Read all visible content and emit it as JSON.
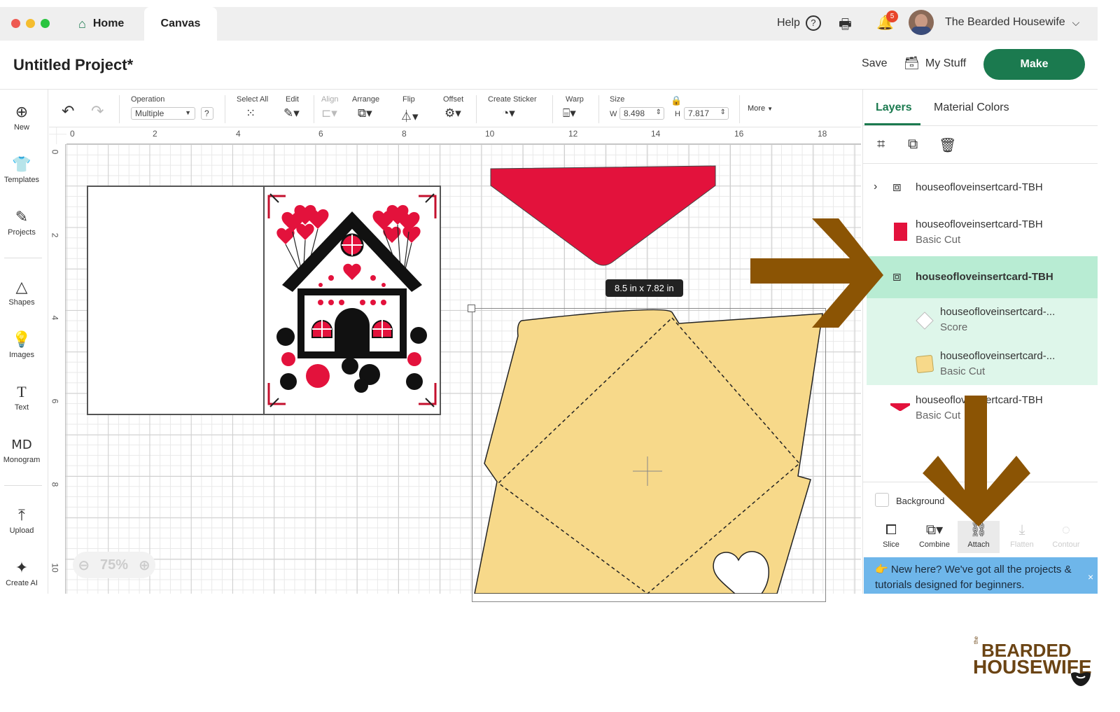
{
  "window": {
    "tabs": [
      {
        "label": "Home"
      },
      {
        "label": "Canvas"
      }
    ],
    "help_label": "Help",
    "notification_count": "5",
    "user_name": "The Bearded Housewife"
  },
  "header": {
    "project_title": "Untitled Project*",
    "save_label": "Save",
    "mystuff_label": "My Stuff",
    "make_label": "Make"
  },
  "sidebar": {
    "items": [
      {
        "label": "New",
        "icon": "plus-circle-icon"
      },
      {
        "label": "Templates",
        "icon": "shirt-icon"
      },
      {
        "label": "Projects",
        "icon": "projects-icon"
      },
      {
        "label": "Shapes",
        "icon": "shapes-icon"
      },
      {
        "label": "Images",
        "icon": "lightbulb-icon"
      },
      {
        "label": "Text",
        "icon": "text-icon"
      },
      {
        "label": "Monogram",
        "icon": "monogram-icon"
      },
      {
        "label": "Upload",
        "icon": "upload-icon"
      },
      {
        "label": "Create AI",
        "icon": "sparkle-icon"
      }
    ]
  },
  "toolbar": {
    "operation_label": "Operation",
    "operation_value": "Multiple",
    "operation_help": "?",
    "select_all_label": "Select All",
    "edit_label": "Edit",
    "align_label": "Align",
    "arrange_label": "Arrange",
    "flip_label": "Flip",
    "offset_label": "Offset",
    "create_sticker_label": "Create Sticker",
    "warp_label": "Warp",
    "size_label": "Size",
    "width_prefix": "W",
    "width_value": "8.498",
    "height_prefix": "H",
    "height_value": "7.817",
    "more_label": "More"
  },
  "canvas": {
    "ruler_top": [
      "0",
      "2",
      "4",
      "6",
      "8",
      "10",
      "12",
      "14",
      "16",
      "18"
    ],
    "ruler_left": [
      "0",
      "2",
      "4",
      "6",
      "8",
      "10"
    ],
    "size_tooltip": "8.5  in x 7.82  in",
    "zoom_level": "75%"
  },
  "panel": {
    "tabs": [
      {
        "label": "Layers"
      },
      {
        "label": "Material Colors"
      }
    ],
    "layers": [
      {
        "name": "houseofloveinsertcard-TBH",
        "sub": ""
      },
      {
        "name": "houseofloveinsertcard-TBH",
        "sub": "Basic Cut",
        "color": "#e3123c"
      },
      {
        "name": "houseofloveinsertcard-TBH",
        "sub": ""
      },
      {
        "name": "houseofloveinsertcard-...",
        "sub": "Score"
      },
      {
        "name": "houseofloveinsertcard-...",
        "sub": "Basic Cut",
        "color": "#f7d98a"
      },
      {
        "name": "houseofloveinsertcard-TBH",
        "sub": "Basic Cut",
        "color": "#e3123c"
      }
    ],
    "background_label": "Background",
    "actions": [
      {
        "label": "Slice"
      },
      {
        "label": "Combine"
      },
      {
        "label": "Attach"
      },
      {
        "label": "Flatten"
      },
      {
        "label": "Contour"
      }
    ],
    "banner_text": "New here? We've got all the projects & tutorials designed for beginners.",
    "banner_close": "×"
  },
  "logo": {
    "line1": "BEARDED",
    "line2": "HOUSEWIFE",
    "the": "the"
  },
  "colors": {
    "accent": "#1b7a4f",
    "selected_row": "#b8ecd3",
    "red_cut": "#e3123c",
    "envelope": "#f7d98a",
    "arrow": "#8b5404",
    "banner": "#6eb6ea"
  }
}
